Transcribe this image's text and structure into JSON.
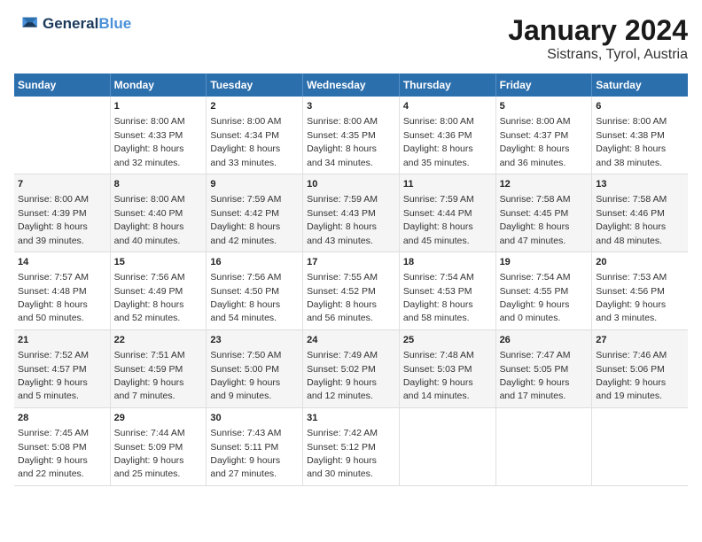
{
  "logo": {
    "line1": "General",
    "line2": "Blue"
  },
  "title": "January 2024",
  "subtitle": "Sistrans, Tyrol, Austria",
  "header": {
    "days": [
      "Sunday",
      "Monday",
      "Tuesday",
      "Wednesday",
      "Thursday",
      "Friday",
      "Saturday"
    ]
  },
  "weeks": [
    [
      {
        "num": "",
        "sunrise": "",
        "sunset": "",
        "daylight": ""
      },
      {
        "num": "1",
        "sunrise": "8:00 AM",
        "sunset": "4:33 PM",
        "daylight": "8 hours and 32 minutes."
      },
      {
        "num": "2",
        "sunrise": "8:00 AM",
        "sunset": "4:34 PM",
        "daylight": "8 hours and 33 minutes."
      },
      {
        "num": "3",
        "sunrise": "8:00 AM",
        "sunset": "4:35 PM",
        "daylight": "8 hours and 34 minutes."
      },
      {
        "num": "4",
        "sunrise": "8:00 AM",
        "sunset": "4:36 PM",
        "daylight": "8 hours and 35 minutes."
      },
      {
        "num": "5",
        "sunrise": "8:00 AM",
        "sunset": "4:37 PM",
        "daylight": "8 hours and 36 minutes."
      },
      {
        "num": "6",
        "sunrise": "8:00 AM",
        "sunset": "4:38 PM",
        "daylight": "8 hours and 38 minutes."
      }
    ],
    [
      {
        "num": "7",
        "sunrise": "8:00 AM",
        "sunset": "4:39 PM",
        "daylight": "8 hours and 39 minutes."
      },
      {
        "num": "8",
        "sunrise": "8:00 AM",
        "sunset": "4:40 PM",
        "daylight": "8 hours and 40 minutes."
      },
      {
        "num": "9",
        "sunrise": "7:59 AM",
        "sunset": "4:42 PM",
        "daylight": "8 hours and 42 minutes."
      },
      {
        "num": "10",
        "sunrise": "7:59 AM",
        "sunset": "4:43 PM",
        "daylight": "8 hours and 43 minutes."
      },
      {
        "num": "11",
        "sunrise": "7:59 AM",
        "sunset": "4:44 PM",
        "daylight": "8 hours and 45 minutes."
      },
      {
        "num": "12",
        "sunrise": "7:58 AM",
        "sunset": "4:45 PM",
        "daylight": "8 hours and 47 minutes."
      },
      {
        "num": "13",
        "sunrise": "7:58 AM",
        "sunset": "4:46 PM",
        "daylight": "8 hours and 48 minutes."
      }
    ],
    [
      {
        "num": "14",
        "sunrise": "7:57 AM",
        "sunset": "4:48 PM",
        "daylight": "8 hours and 50 minutes."
      },
      {
        "num": "15",
        "sunrise": "7:56 AM",
        "sunset": "4:49 PM",
        "daylight": "8 hours and 52 minutes."
      },
      {
        "num": "16",
        "sunrise": "7:56 AM",
        "sunset": "4:50 PM",
        "daylight": "8 hours and 54 minutes."
      },
      {
        "num": "17",
        "sunrise": "7:55 AM",
        "sunset": "4:52 PM",
        "daylight": "8 hours and 56 minutes."
      },
      {
        "num": "18",
        "sunrise": "7:54 AM",
        "sunset": "4:53 PM",
        "daylight": "8 hours and 58 minutes."
      },
      {
        "num": "19",
        "sunrise": "7:54 AM",
        "sunset": "4:55 PM",
        "daylight": "9 hours and 0 minutes."
      },
      {
        "num": "20",
        "sunrise": "7:53 AM",
        "sunset": "4:56 PM",
        "daylight": "9 hours and 3 minutes."
      }
    ],
    [
      {
        "num": "21",
        "sunrise": "7:52 AM",
        "sunset": "4:57 PM",
        "daylight": "9 hours and 5 minutes."
      },
      {
        "num": "22",
        "sunrise": "7:51 AM",
        "sunset": "4:59 PM",
        "daylight": "9 hours and 7 minutes."
      },
      {
        "num": "23",
        "sunrise": "7:50 AM",
        "sunset": "5:00 PM",
        "daylight": "9 hours and 9 minutes."
      },
      {
        "num": "24",
        "sunrise": "7:49 AM",
        "sunset": "5:02 PM",
        "daylight": "9 hours and 12 minutes."
      },
      {
        "num": "25",
        "sunrise": "7:48 AM",
        "sunset": "5:03 PM",
        "daylight": "9 hours and 14 minutes."
      },
      {
        "num": "26",
        "sunrise": "7:47 AM",
        "sunset": "5:05 PM",
        "daylight": "9 hours and 17 minutes."
      },
      {
        "num": "27",
        "sunrise": "7:46 AM",
        "sunset": "5:06 PM",
        "daylight": "9 hours and 19 minutes."
      }
    ],
    [
      {
        "num": "28",
        "sunrise": "7:45 AM",
        "sunset": "5:08 PM",
        "daylight": "9 hours and 22 minutes."
      },
      {
        "num": "29",
        "sunrise": "7:44 AM",
        "sunset": "5:09 PM",
        "daylight": "9 hours and 25 minutes."
      },
      {
        "num": "30",
        "sunrise": "7:43 AM",
        "sunset": "5:11 PM",
        "daylight": "9 hours and 27 minutes."
      },
      {
        "num": "31",
        "sunrise": "7:42 AM",
        "sunset": "5:12 PM",
        "daylight": "9 hours and 30 minutes."
      },
      {
        "num": "",
        "sunrise": "",
        "sunset": "",
        "daylight": ""
      },
      {
        "num": "",
        "sunrise": "",
        "sunset": "",
        "daylight": ""
      },
      {
        "num": "",
        "sunrise": "",
        "sunset": "",
        "daylight": ""
      }
    ]
  ]
}
